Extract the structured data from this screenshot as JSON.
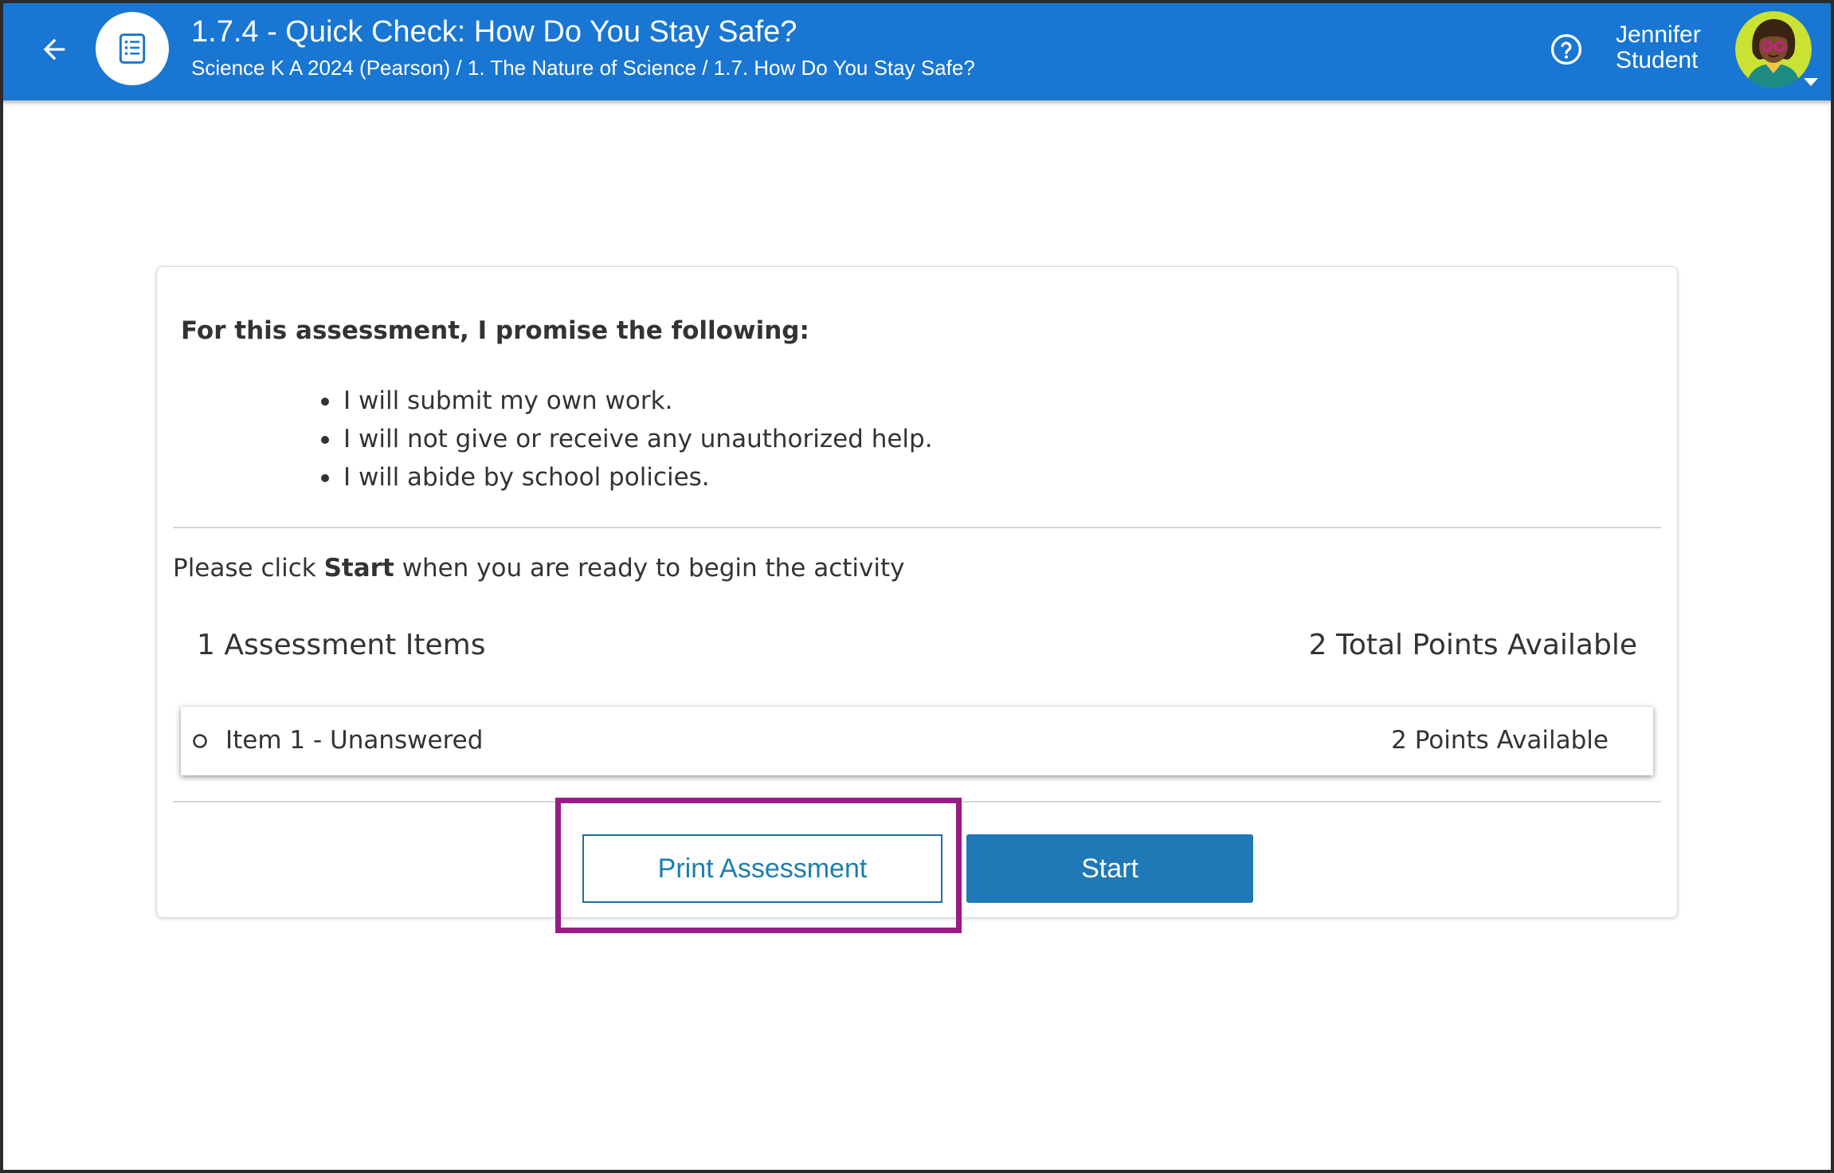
{
  "colors": {
    "brand": "#1976d2",
    "accent": "#1e79b6",
    "highlight": "#9b1a87",
    "text": "#333333"
  },
  "header": {
    "back_icon": "arrow-left-icon",
    "activity_icon": "checklist-icon",
    "title": "1.7.4 - Quick Check: How Do You Stay Safe?",
    "breadcrumb": "Science K A 2024 (Pearson) / 1. The Nature of Science / 1.7. How Do You Stay Safe?",
    "help_icon": "help-circle-icon",
    "user": {
      "first_name": "Jennifer",
      "last_name": "Student",
      "avatar_icon": "student-avatar",
      "menu_icon": "caret-down-icon"
    }
  },
  "assessment": {
    "promise_heading": "For this assessment, I promise the following:",
    "promises": [
      "I will submit my own work.",
      "I will not give or receive any unauthorized help.",
      "I will abide by school policies."
    ],
    "instructions": {
      "before": "Please click ",
      "emphasis": "Start",
      "after": " when you are ready to begin the activity"
    },
    "items_count": "1 Assessment Items",
    "total_points": "2 Total Points Available",
    "items": [
      {
        "label": "Item 1 - Unanswered",
        "points": "2 Points Available",
        "status_icon": "empty-circle-icon"
      }
    ],
    "buttons": {
      "print": "Print Assessment",
      "start": "Start"
    }
  }
}
